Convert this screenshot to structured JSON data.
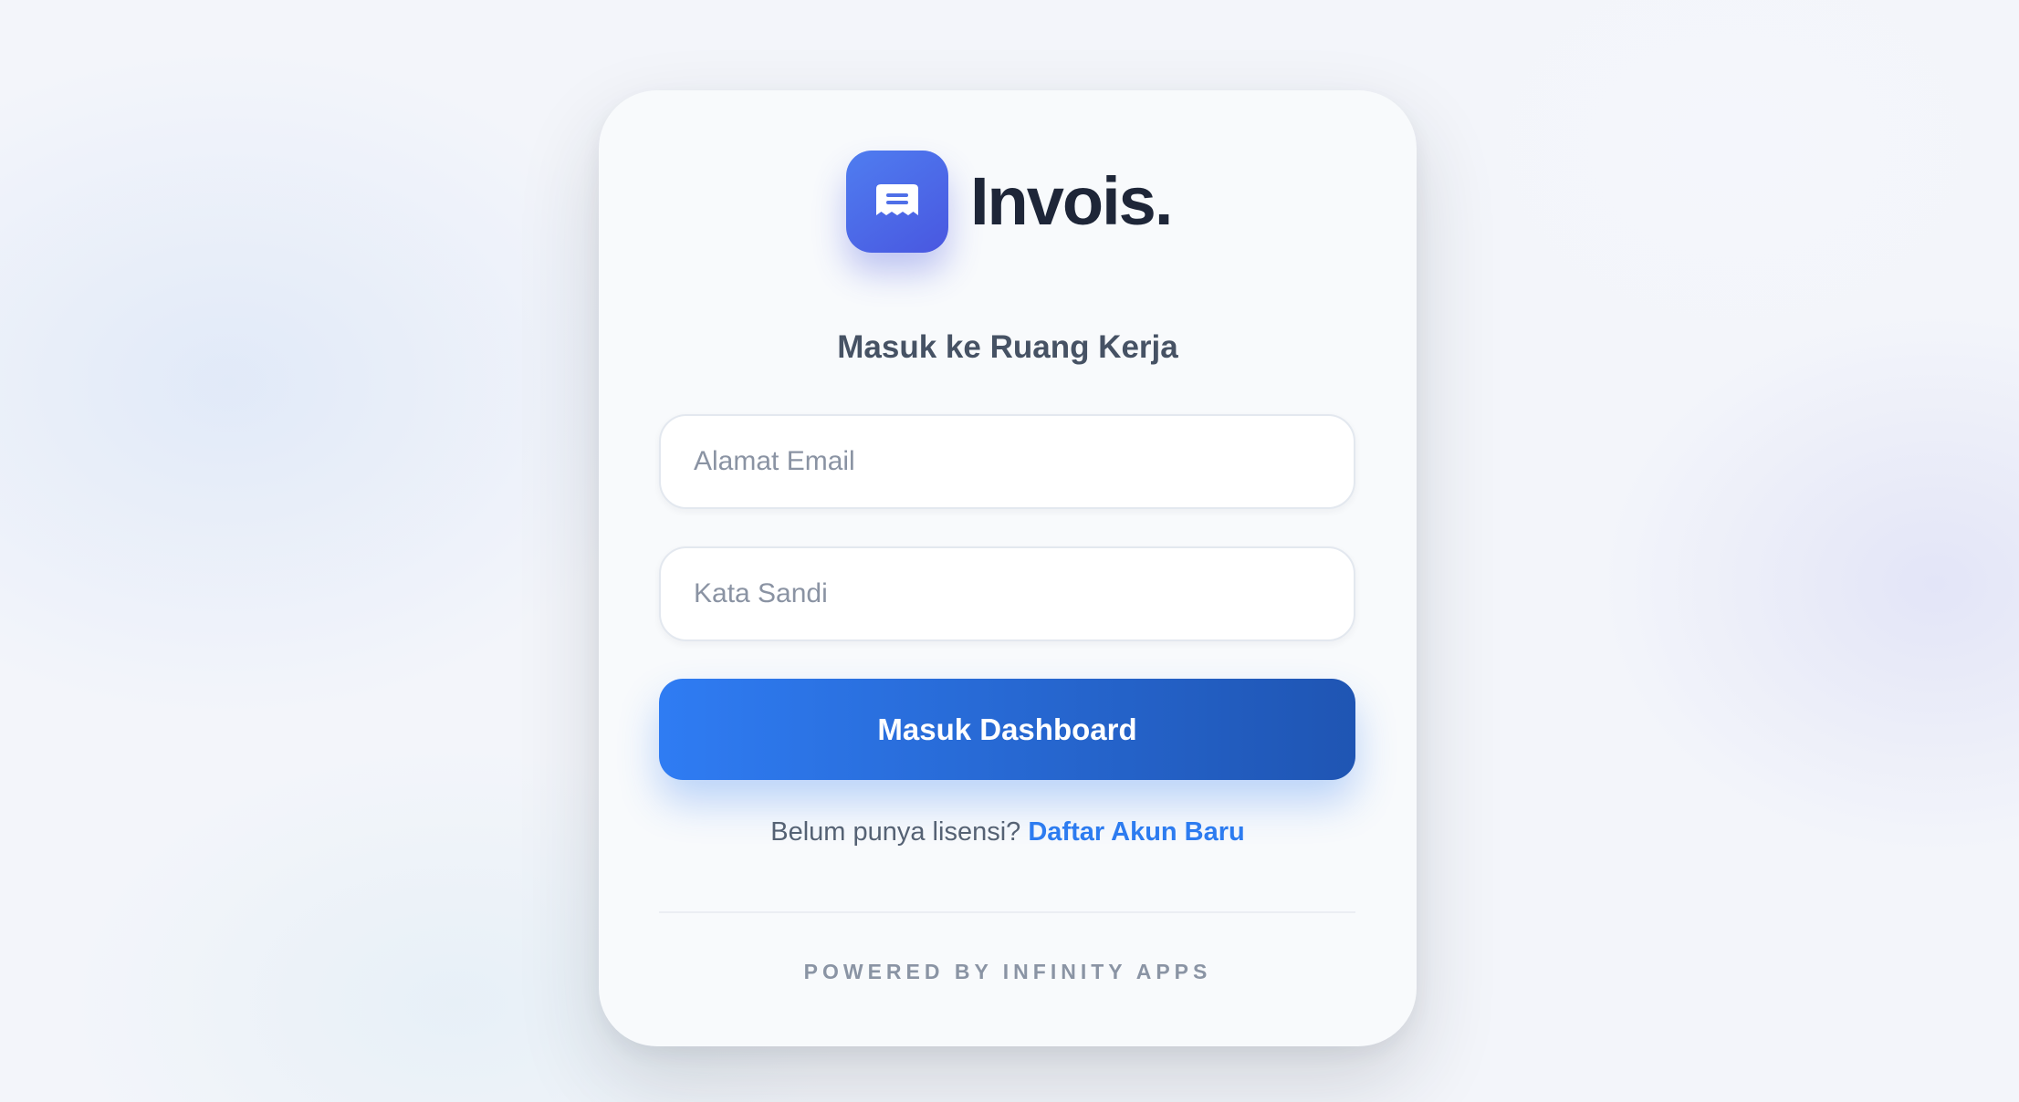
{
  "brand": {
    "name": "Invois.",
    "logo_icon": "receipt-icon",
    "logo_color_start": "#4f7df0",
    "logo_color_end": "#4957e0"
  },
  "login": {
    "heading": "Masuk ke Ruang Kerja",
    "email_placeholder": "Alamat Email",
    "email_value": "",
    "password_placeholder": "Kata Sandi",
    "password_value": "",
    "submit_label": "Masuk Dashboard",
    "signup_prompt": "Belum punya lisensi?",
    "signup_link": "Daftar Akun Baru"
  },
  "footer": {
    "text": "POWERED BY INFINITY APPS"
  },
  "colors": {
    "accent": "#2d7cf0",
    "button_gradient_start": "#2f7cf3",
    "button_gradient_end": "#1f55b3",
    "heading": "#465264",
    "brand_text": "#1e2638"
  }
}
